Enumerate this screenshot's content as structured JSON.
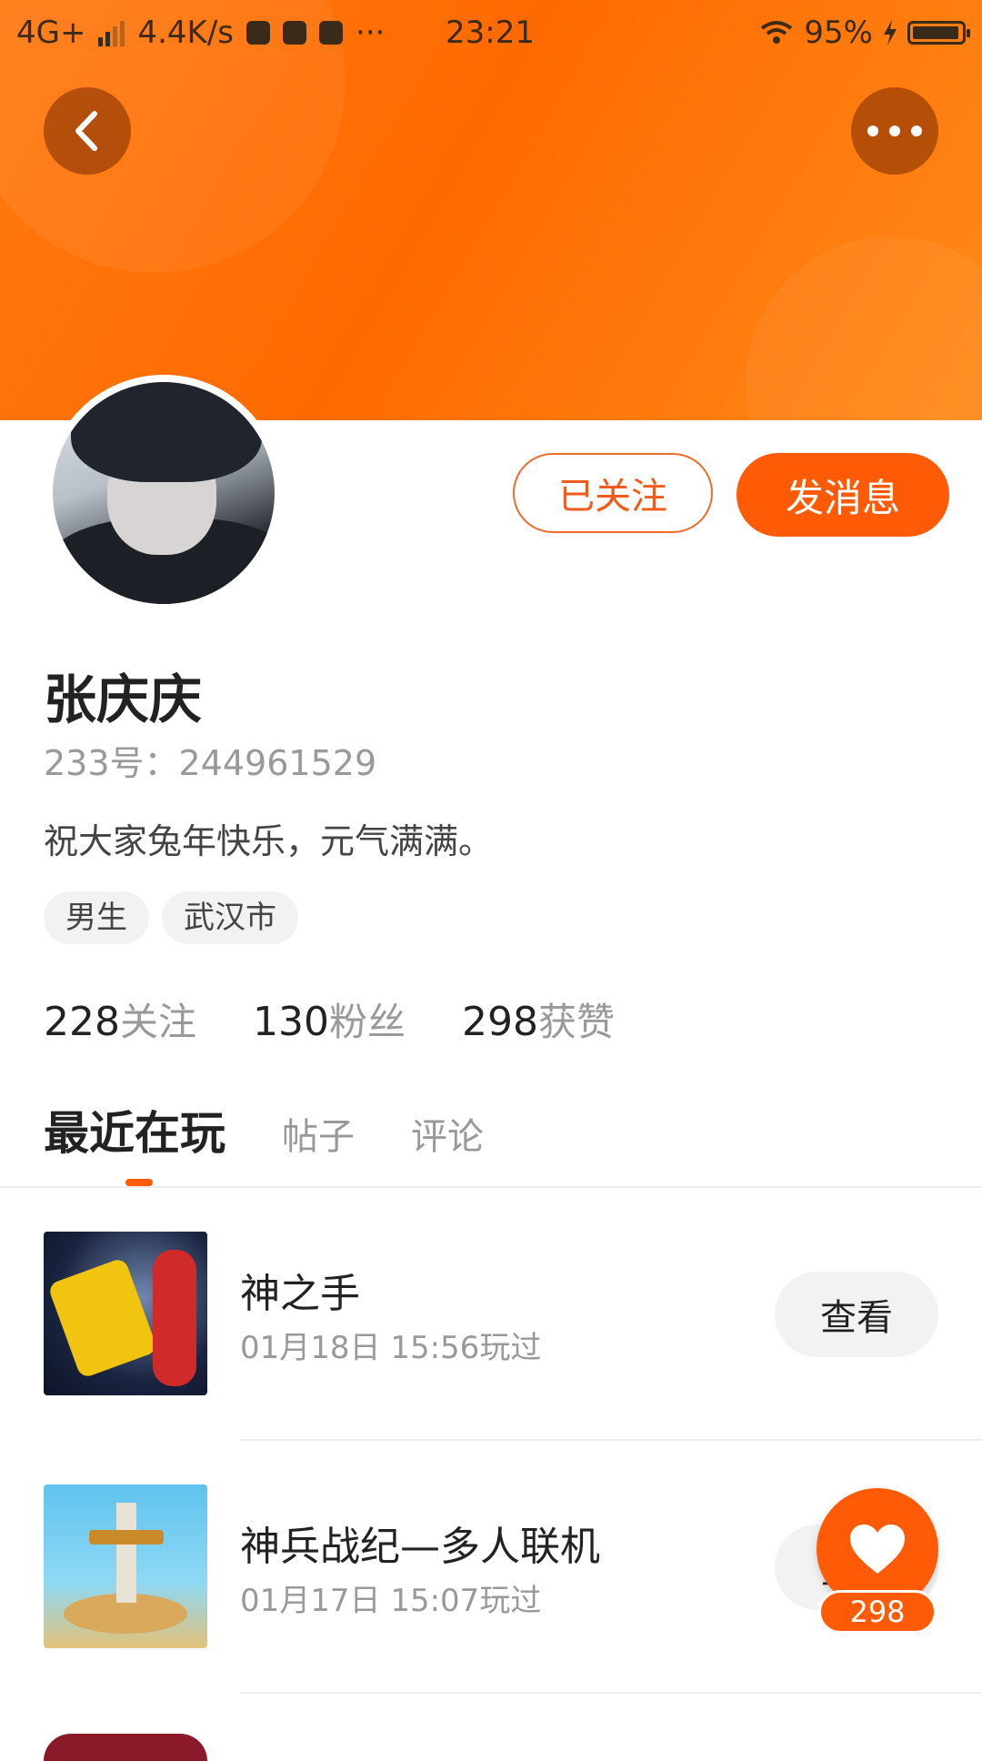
{
  "status_bar": {
    "network": "4G+",
    "speed": "4.4K/s",
    "more": "···",
    "time": "23:21",
    "battery": "95%"
  },
  "header": {
    "back_icon": "chevron-left-icon",
    "more_icon": "more-horizontal-icon"
  },
  "profile": {
    "follow_button": "已关注",
    "message_button": "发消息",
    "name": "张庆庆",
    "id_text": "233号：244961529",
    "bio": "祝大家兔年快乐，元气满满。",
    "tags": [
      "男生",
      "武汉市"
    ],
    "stats": [
      {
        "num": "228",
        "label": "关注"
      },
      {
        "num": "130",
        "label": "粉丝"
      },
      {
        "num": "298",
        "label": "获赞"
      }
    ]
  },
  "tabs": [
    {
      "label": "最近在玩",
      "active": true
    },
    {
      "label": "帖子",
      "active": false
    },
    {
      "label": "评论",
      "active": false
    }
  ],
  "games": [
    {
      "name": "神之手",
      "played": "01月18日 15:56玩过",
      "button": "查看"
    },
    {
      "name": "神兵战纪—多人联机",
      "played": "01月17日 15:07玩过",
      "button": "查看"
    }
  ],
  "like": {
    "icon": "heart-icon",
    "count": "298"
  },
  "colors": {
    "accent": "#ff5a05",
    "header_gradient_start": "#ff7a12",
    "header_gradient_end": "#ff8a1a"
  }
}
